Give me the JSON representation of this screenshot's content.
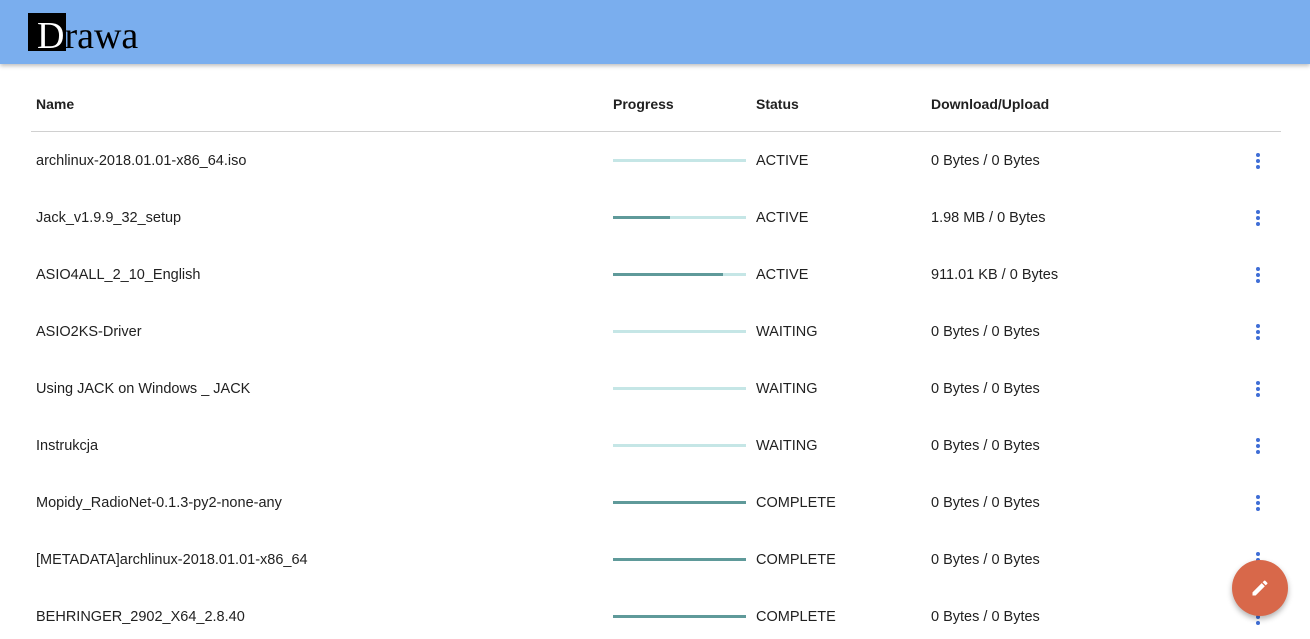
{
  "app": {
    "logo_text": "Drawa",
    "colors": {
      "appbar": "#7aaeee",
      "progress_track": "#c5e6e6",
      "progress_fill": "#5f9a9a",
      "menu_icon": "#3f6ed6",
      "fab": "#d8684a"
    }
  },
  "table": {
    "headers": {
      "name": "Name",
      "progress": "Progress",
      "status": "Status",
      "transfer": "Download/Upload"
    },
    "rows": [
      {
        "name": "archlinux-2018.01.01-x86_64.iso",
        "progress": 0.0,
        "status": "ACTIVE",
        "transfer": "0 Bytes / 0 Bytes"
      },
      {
        "name": "Jack_v1.9.9_32_setup",
        "progress": 0.43,
        "status": "ACTIVE",
        "transfer": "1.98 MB / 0 Bytes"
      },
      {
        "name": "ASIO4ALL_2_10_English",
        "progress": 0.83,
        "status": "ACTIVE",
        "transfer": "911.01 KB / 0 Bytes"
      },
      {
        "name": "ASIO2KS-Driver",
        "progress": 0.0,
        "status": "WAITING",
        "transfer": "0 Bytes / 0 Bytes"
      },
      {
        "name": "Using JACK on Windows _ JACK",
        "progress": 0.0,
        "status": "WAITING",
        "transfer": "0 Bytes / 0 Bytes"
      },
      {
        "name": "Instrukcja",
        "progress": 0.0,
        "status": "WAITING",
        "transfer": "0 Bytes / 0 Bytes"
      },
      {
        "name": "Mopidy_RadioNet-0.1.3-py2-none-any",
        "progress": 1.0,
        "status": "COMPLETE",
        "transfer": "0 Bytes / 0 Bytes"
      },
      {
        "name": "[METADATA]archlinux-2018.01.01-x86_64",
        "progress": 1.0,
        "status": "COMPLETE",
        "transfer": "0 Bytes / 0 Bytes"
      },
      {
        "name": "BEHRINGER_2902_X64_2.8.40",
        "progress": 1.0,
        "status": "COMPLETE",
        "transfer": "0 Bytes / 0 Bytes"
      }
    ]
  },
  "icons": {
    "row_menu": "more-vert-icon",
    "fab": "pencil-icon"
  }
}
